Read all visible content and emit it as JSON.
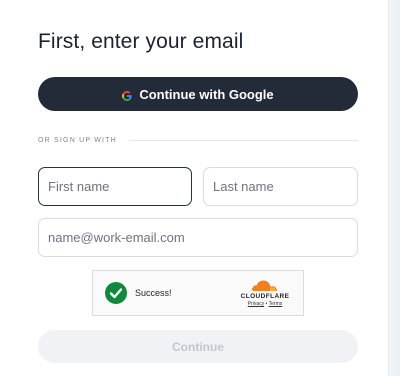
{
  "form": {
    "title": "First, enter your email",
    "google_button_label": "Continue with Google",
    "divider_label": "OR SIGN UP WITH",
    "first_name_placeholder": "First name",
    "last_name_placeholder": "Last name",
    "email_placeholder": "name@work-email.com",
    "continue_label": "Continue"
  },
  "captcha": {
    "status": "Success!",
    "brand": "CLOUDFLARE",
    "privacy_link": "Privacy",
    "separator": "•",
    "terms_link": "Terms"
  },
  "icons": {
    "google": "google-g-icon",
    "success": "success-check-icon",
    "cloudflare": "cloudflare-logo"
  },
  "colors": {
    "primary_button": "#232a38",
    "success_green": "#0f8a3c",
    "cloudflare_orange": "#f38020",
    "disabled_button": "#f1f2f5"
  }
}
